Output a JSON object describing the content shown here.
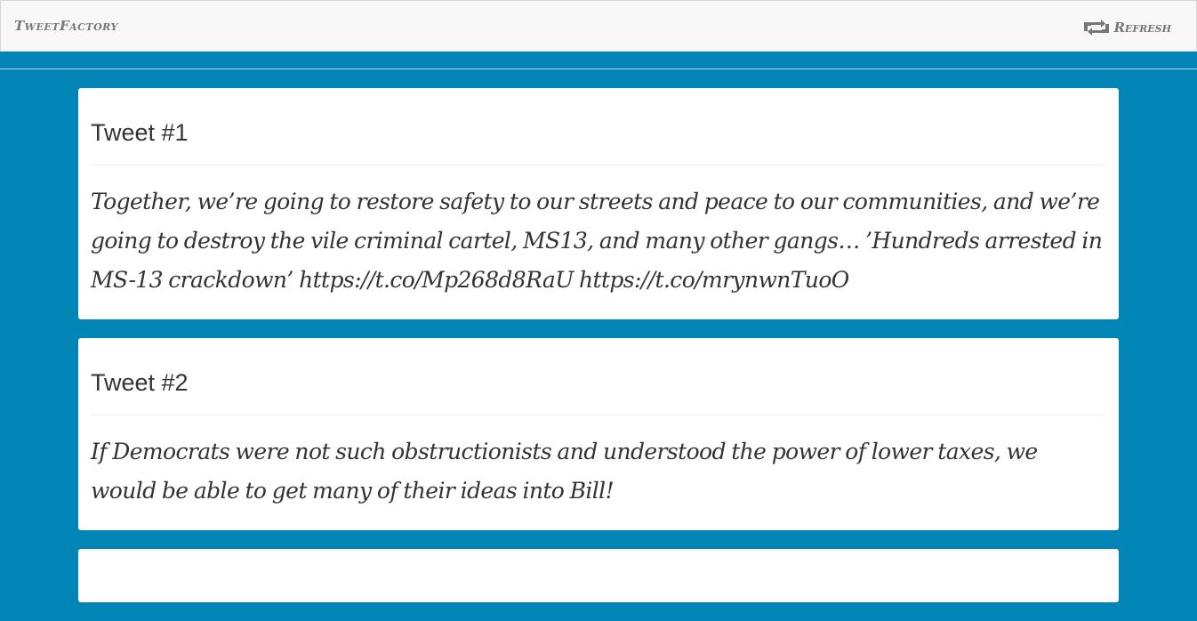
{
  "navbar": {
    "brand": "TweetFactory",
    "refresh_label": "Refresh"
  },
  "icons": {
    "refresh": "retweet-icon"
  },
  "colors": {
    "background": "#0085b6",
    "card": "#ffffff",
    "navbar": "#f8f8f8"
  },
  "tweets": [
    {
      "title": "Tweet #1",
      "text": "Together, we’re going to restore safety to our streets and peace to our communities, and we’re going to destroy the vile criminal cartel,  MS13, and many other gangs… ’Hundreds arrested in MS-13 crackdown’ https://t.co/Mp268d8RaU https://t.co/mrynwnTuoO"
    },
    {
      "title": "Tweet #2",
      "text": "If Democrats were not such obstructionists and understood the power of lower taxes, we would be able to get many of their ideas into Bill!"
    }
  ]
}
